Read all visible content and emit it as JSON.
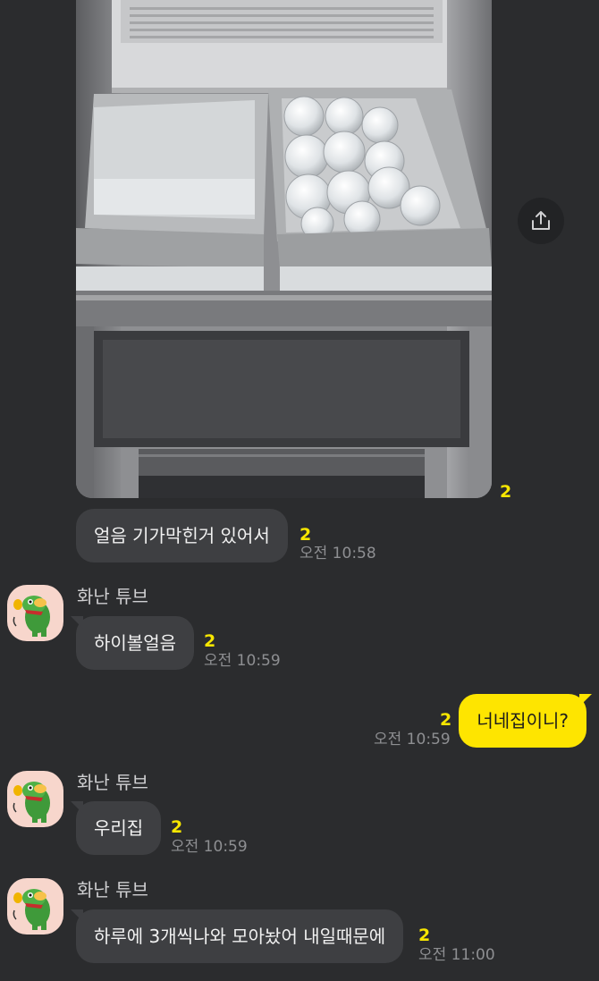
{
  "photo_message": {
    "unread": "2"
  },
  "messages": [
    {
      "text": "얼음 기가막힌거 있어서",
      "unread": "2",
      "time": "오전 10:58"
    },
    {
      "sender": "화난 튜브",
      "text": "하이볼얼음",
      "unread": "2",
      "time": "오전 10:59"
    },
    {
      "text": "너네집이니?",
      "unread": "2",
      "time": "오전 10:59"
    },
    {
      "sender": "화난 튜브",
      "text": "우리집",
      "unread": "2",
      "time": "오전 10:59"
    },
    {
      "sender": "화난 튜브",
      "text": "하루에 3개씩나와 모아놨어 내일때문에",
      "unread": "2",
      "time": "오전 11:00"
    }
  ],
  "icons": {
    "share": "share-icon",
    "avatar": "angry-tube-avatar-icon"
  },
  "colors": {
    "background": "#2b2c2e",
    "bubble_other": "#3e3f42",
    "bubble_mine": "#fee500",
    "unread": "#f7e600",
    "time": "#8e8f92"
  }
}
